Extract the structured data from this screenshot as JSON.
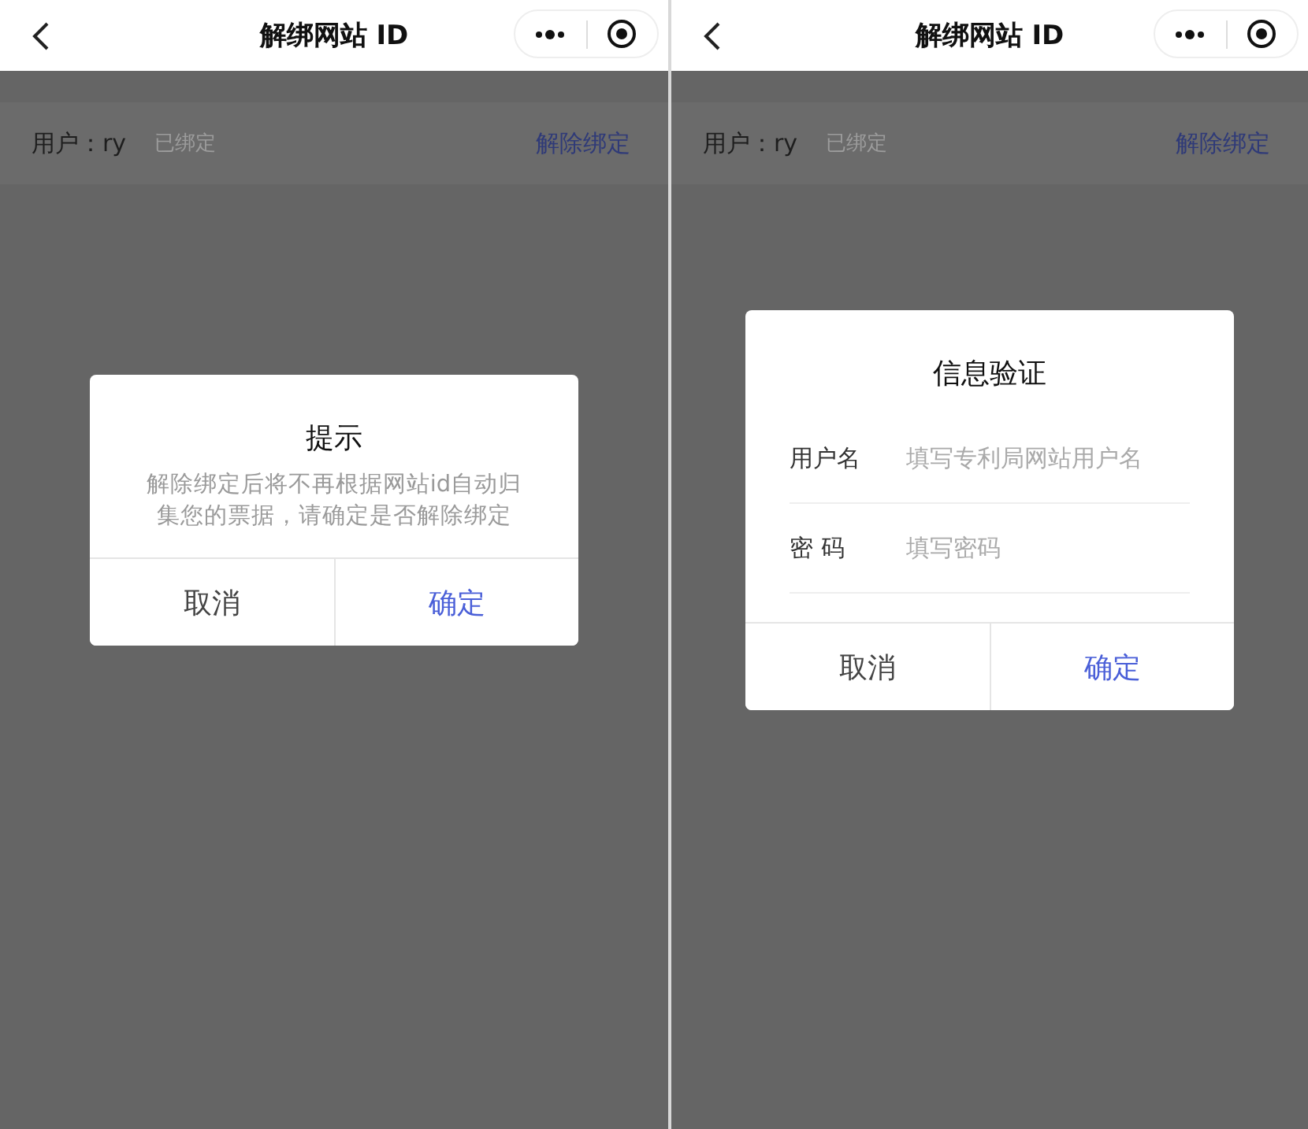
{
  "screens": [
    {
      "nav": {
        "title": "解绑网站 ID"
      },
      "account": {
        "user": "用户：ry",
        "status": "已绑定",
        "action": "解除绑定"
      },
      "dialog": {
        "kind": "confirm",
        "title": "提示",
        "message": "解除绑定后将不再根据网站id自动归集您的票据，请确定是否解除绑定",
        "buttons": [
          {
            "label": "取消",
            "kind": "cancel"
          },
          {
            "label": "确定",
            "kind": "confirm"
          }
        ]
      }
    },
    {
      "nav": {
        "title": "解绑网站 ID"
      },
      "account": {
        "user": "用户：ry",
        "status": "已绑定",
        "action": "解除绑定"
      },
      "dialog": {
        "kind": "form",
        "title": "信息验证",
        "fields": [
          {
            "label": "用户名",
            "placeholder": "填写专利局网站用户名"
          },
          {
            "label": "密 码",
            "placeholder": "填写密码"
          }
        ],
        "buttons": [
          {
            "label": "取消",
            "kind": "cancel"
          },
          {
            "label": "确定",
            "kind": "confirm"
          }
        ]
      }
    }
  ]
}
